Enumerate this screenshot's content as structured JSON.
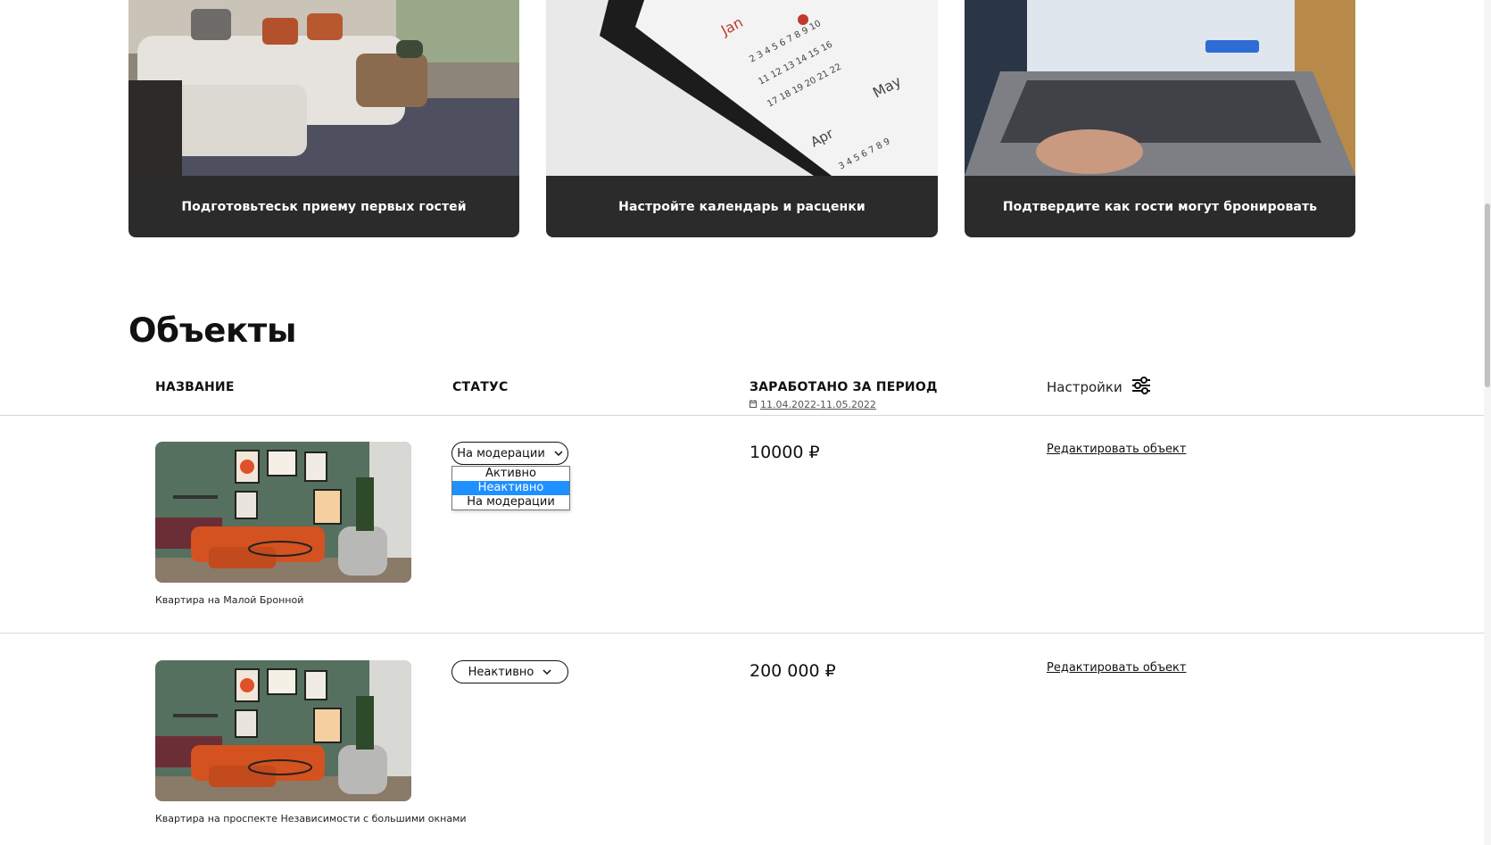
{
  "cards": [
    {
      "caption": "Подготовьтеськ приему первых гостей"
    },
    {
      "caption": "Настройте календарь и расценки"
    },
    {
      "caption": "Подтвердите как гости могут бронировать"
    }
  ],
  "section_title": "Объекты",
  "table": {
    "headers": {
      "name": "НАЗВАНИЕ",
      "status": "СТАТУС",
      "earned": "ЗАРАБОТАНО ЗА ПЕРИОД",
      "settings": "Настройки"
    },
    "period": "11.04.2022-11.05.2022"
  },
  "status_options": [
    "Активно",
    "Неактивно",
    "На модерации"
  ],
  "rows": [
    {
      "title": "Квартира на Малой Бронной",
      "status": "На модерации",
      "amount": "10000 ₽",
      "edit_label": "Редактировать объект"
    },
    {
      "title": "Квартира на проспекте Независимости с большими окнами",
      "status": "Неактивно",
      "amount": "200 000 ₽",
      "edit_label": "Редактировать объект"
    }
  ],
  "dropdown": {
    "open_row": 0,
    "highlighted": "Неактивно"
  },
  "colors": {
    "card_caption_bg": "#2b2b2b",
    "dropdown_highlight": "#1e90ff",
    "divider": "#d6d6d6"
  }
}
